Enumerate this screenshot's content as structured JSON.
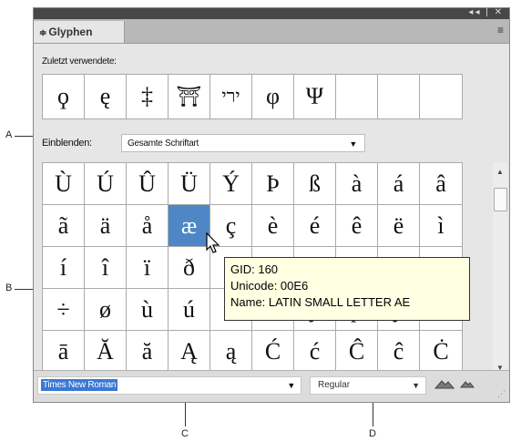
{
  "callouts": {
    "a": "A",
    "b": "B",
    "c": "C",
    "d": "D"
  },
  "panel": {
    "tab_label": "Glyphen",
    "tab_arrows": "≑",
    "title_controls": "◂◂ | ✕",
    "menu_icon": "≡"
  },
  "recent": {
    "label": "Zuletzt verwendete:",
    "glyphs": [
      "ϙ",
      "ę",
      "‡",
      "⛩",
      "ירי",
      "φ",
      "Ψ",
      "",
      "",
      ""
    ]
  },
  "show": {
    "label": "Einblenden:",
    "value": "Gesamte Schriftart",
    "dropdown_icon": "▼"
  },
  "glyph_grid": [
    [
      "Ù",
      "Ú",
      "Û",
      "Ü",
      "Ý",
      "Þ",
      "ß",
      "à",
      "á",
      "â"
    ],
    [
      "ã",
      "ä",
      "å",
      "æ",
      "ç",
      "è",
      "é",
      "ê",
      "ë",
      "ì"
    ],
    [
      "í",
      "î",
      "ï",
      "ð",
      "",
      "",
      "",
      "",
      "",
      "ó"
    ],
    [
      "÷",
      "ø",
      "ù",
      "ú",
      "",
      "",
      "ý",
      "þ",
      "ÿ",
      "Ā"
    ],
    [
      "ā",
      "Ă",
      "ă",
      "Ą",
      "ą",
      "Ć",
      "ć",
      "Ĉ",
      "ĉ",
      "Ċ"
    ]
  ],
  "selected_glyph": "æ",
  "tooltip": {
    "gid": "GID: 160",
    "unicode": "Unicode: 00E6",
    "name": "Name: LATIN SMALL LETTER AE"
  },
  "font": {
    "family": "Times New Roman",
    "style": "Regular",
    "dropdown_icon": "▼"
  },
  "colors": {
    "selection": "#4f86c6",
    "tooltip_bg": "#ffffe1"
  }
}
